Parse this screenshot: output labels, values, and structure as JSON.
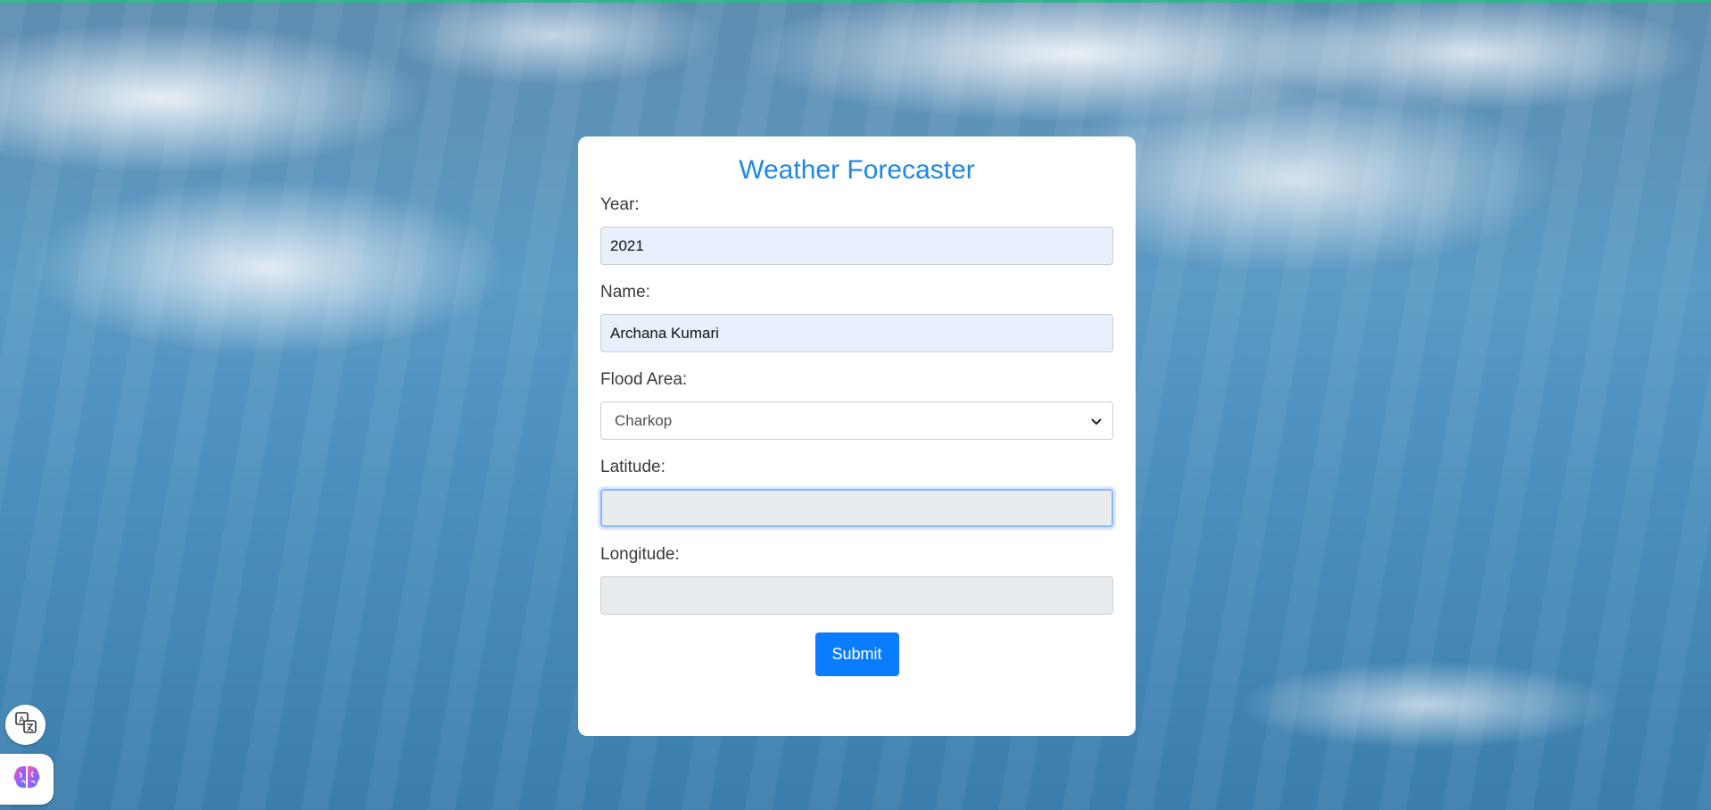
{
  "page": {
    "title": "Weather Forecaster"
  },
  "form": {
    "year": {
      "label": "Year:",
      "value": "2021"
    },
    "name": {
      "label": "Name:",
      "value": "Archana Kumari"
    },
    "flood_area": {
      "label": "Flood Area:",
      "selected": "Charkop"
    },
    "latitude": {
      "label": "Latitude:",
      "value": ""
    },
    "longitude": {
      "label": "Longitude:",
      "value": ""
    },
    "submit_label": "Submit"
  },
  "icons": {
    "translate": "translate-icon",
    "brain": "brain-icon",
    "select_arrow": "chevron-down-icon"
  },
  "colors": {
    "accent": "#1e88e5",
    "button": "#0a7cff",
    "filled_input": "#e8f0fe",
    "disabled_input": "#e9ecef"
  }
}
